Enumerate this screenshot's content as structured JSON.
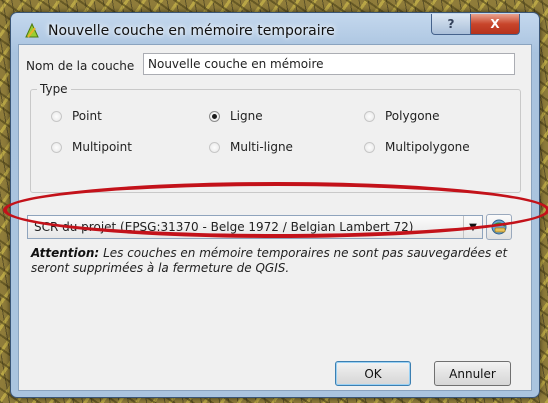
{
  "dialog": {
    "title": "Nouvelle couche en mémoire temporaire",
    "help_button": "?",
    "close_button": "X"
  },
  "layer_name": {
    "label": "Nom de la couche",
    "value": "Nouvelle couche en mémoire"
  },
  "type_group": {
    "legend": "Type",
    "options": [
      {
        "label": "Point",
        "selected": false
      },
      {
        "label": "Ligne",
        "selected": true
      },
      {
        "label": "Polygone",
        "selected": false
      },
      {
        "label": "Multipoint",
        "selected": false
      },
      {
        "label": "Multi-ligne",
        "selected": false
      },
      {
        "label": "Multipolygone",
        "selected": false
      }
    ]
  },
  "crs": {
    "selected": "SCR du projet (EPSG:31370 - Belge 1972 / Belgian Lambert 72)",
    "icon": "globe-select-icon"
  },
  "warning": {
    "prefix": "Attention:",
    "text": "Les couches en mémoire temporaires ne sont pas sauvegardées et seront supprimées à la fermeture de QGIS."
  },
  "buttons": {
    "ok": "OK",
    "cancel": "Annuler"
  },
  "annotation_color": "#c3121a"
}
